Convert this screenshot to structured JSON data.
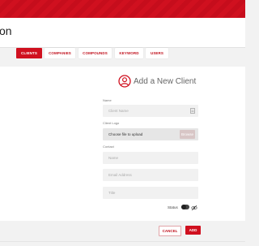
{
  "header": {
    "page_title": "on"
  },
  "tabs": [
    {
      "label": "CLIENTS",
      "active": true
    },
    {
      "label": "COMPANIES",
      "active": false
    },
    {
      "label": "COMPOUNDS",
      "active": false
    },
    {
      "label": "KEYWORD",
      "active": false
    },
    {
      "label": "USERS",
      "active": false
    }
  ],
  "form": {
    "title": "Add a New Client",
    "name_label": "Name",
    "name_placeholder": "Client Name",
    "logo_label": "Client Logo",
    "logo_placeholder": "Choose file to upload",
    "browse_label": "Browse",
    "contact_label": "Contact",
    "contact_name_placeholder": "Name",
    "contact_email_placeholder": "Email Address",
    "contact_title_placeholder": "Title",
    "status_label": "Status",
    "cancel_label": "CANCEL",
    "add_label": "ADD"
  },
  "colors": {
    "accent": "#d0101f",
    "background": "#f2f2f2"
  },
  "icons": {
    "form_icon": "user-circle-icon",
    "name_field_icon": "id-card-icon",
    "status_icon": "eye-off-icon"
  }
}
